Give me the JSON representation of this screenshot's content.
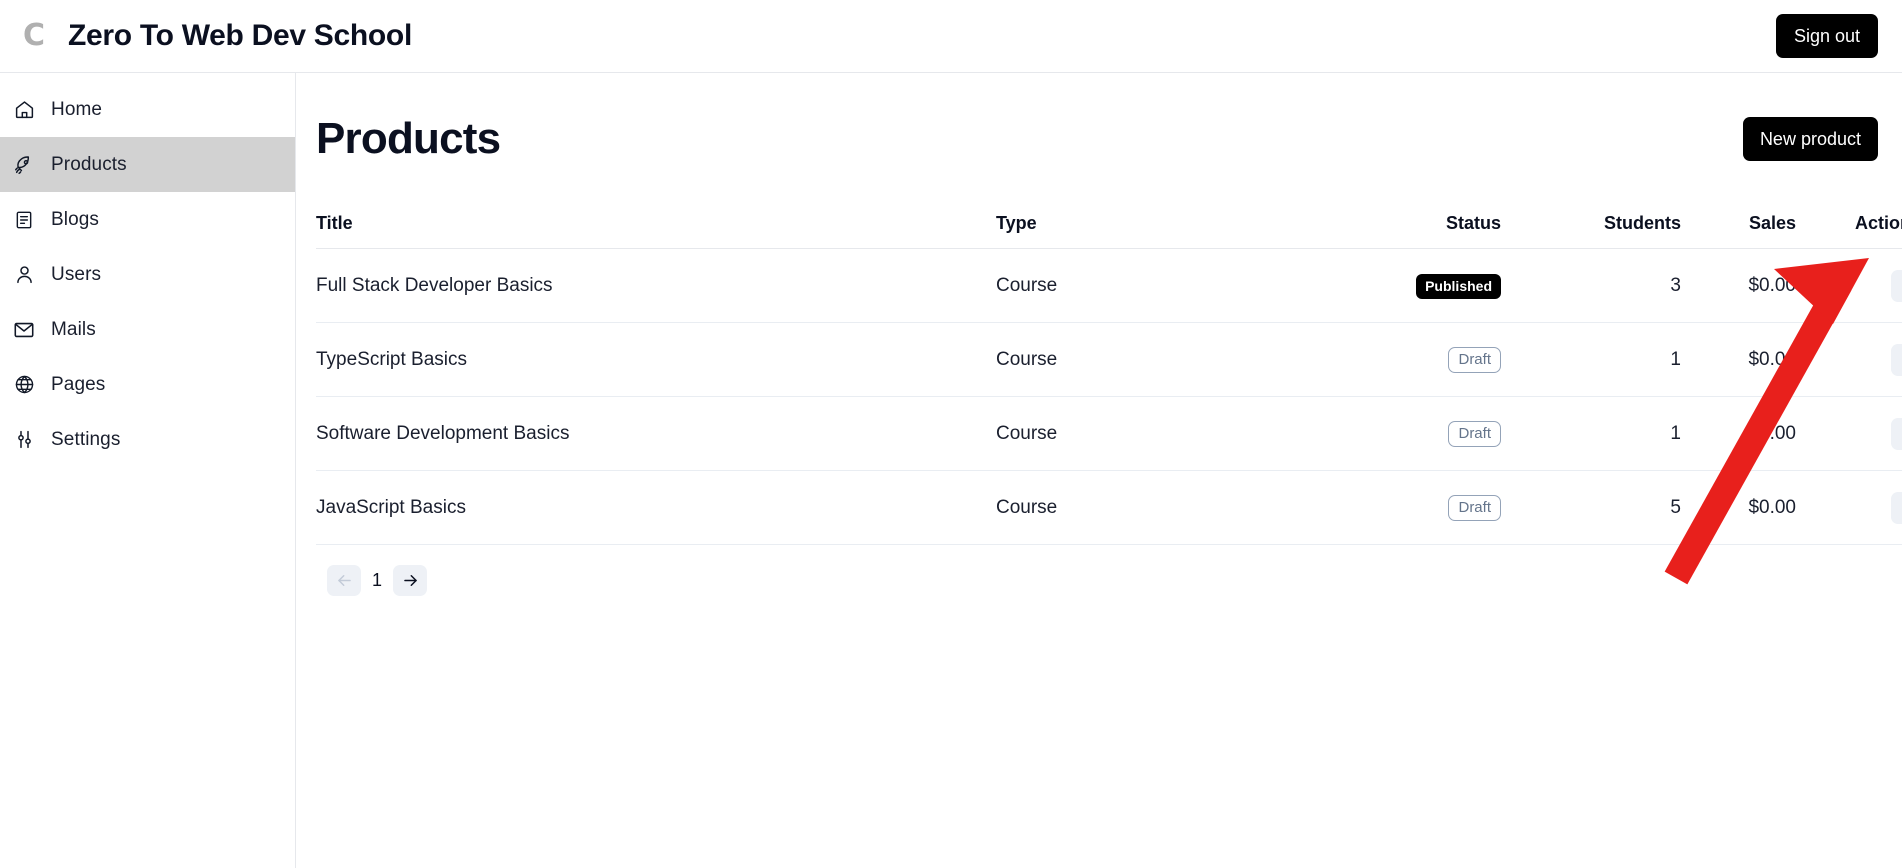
{
  "topbar": {
    "logo_icon": "letter-c-logo-icon",
    "brand_title": "Zero To Web Dev School",
    "sign_out_label": "Sign out"
  },
  "sidebar": {
    "items": [
      {
        "label": "Home",
        "icon": "home-icon",
        "active": false
      },
      {
        "label": "Products",
        "icon": "rocket-icon",
        "active": true
      },
      {
        "label": "Blogs",
        "icon": "document-icon",
        "active": false
      },
      {
        "label": "Users",
        "icon": "user-icon",
        "active": false
      },
      {
        "label": "Mails",
        "icon": "envelope-icon",
        "active": false
      },
      {
        "label": "Pages",
        "icon": "globe-icon",
        "active": false
      },
      {
        "label": "Settings",
        "icon": "sliders-icon",
        "active": false
      }
    ]
  },
  "main": {
    "page_title": "Products",
    "new_product_label": "New product",
    "table": {
      "columns": [
        "Title",
        "Type",
        "Status",
        "Students",
        "Sales",
        "Actions"
      ],
      "rows": [
        {
          "title": "Full Stack Developer Basics",
          "type": "Course",
          "status": "Published",
          "status_variant": "published",
          "students": "3",
          "sales": "$0.00",
          "actions_icon": "kebab-menu-icon"
        },
        {
          "title": "TypeScript Basics",
          "type": "Course",
          "status": "Draft",
          "status_variant": "draft",
          "students": "1",
          "sales": "$0.00",
          "actions_icon": "kebab-menu-icon"
        },
        {
          "title": "Software Development Basics",
          "type": "Course",
          "status": "Draft",
          "status_variant": "draft",
          "students": "1",
          "sales": "$0.00",
          "actions_icon": "kebab-menu-icon"
        },
        {
          "title": "JavaScript Basics",
          "type": "Course",
          "status": "Draft",
          "status_variant": "draft",
          "students": "5",
          "sales": "$0.00",
          "actions_icon": "kebab-menu-icon"
        }
      ]
    },
    "pagination": {
      "prev_icon": "arrow-left-icon",
      "page_number": "1",
      "next_icon": "arrow-right-icon",
      "prev_disabled": true
    }
  },
  "annotation": {
    "type": "arrow",
    "color": "#e8201c",
    "points_at": "row-1-actions-kebab-button"
  },
  "colors": {
    "accent_dark": "#000000",
    "sidebar_active_bg": "#d2d2d2",
    "badge_draft_border": "#94a3b8",
    "badge_draft_text": "#64748b",
    "icon_button_bg": "#eef1f6",
    "border": "#e6e8ec",
    "annotation_red": "#e8201c"
  }
}
